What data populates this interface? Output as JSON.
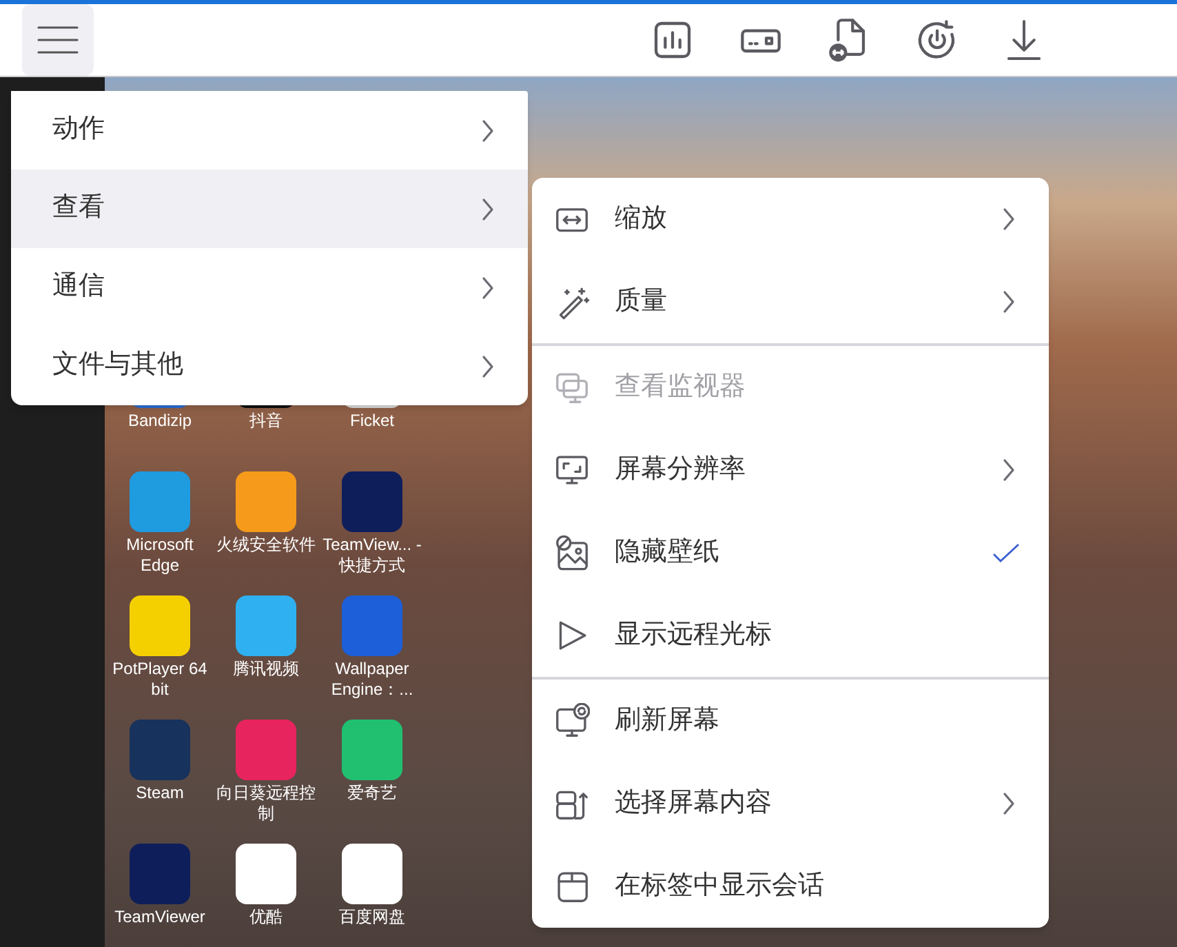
{
  "main_menu": {
    "items": [
      {
        "label": "动作",
        "selected": false
      },
      {
        "label": "查看",
        "selected": true
      },
      {
        "label": "通信",
        "selected": false
      },
      {
        "label": "文件与其他",
        "selected": false
      }
    ]
  },
  "view_submenu": {
    "groups": [
      [
        {
          "label": "缩放",
          "kind": "submenu",
          "disabled": false
        },
        {
          "label": "质量",
          "kind": "submenu",
          "disabled": false
        }
      ],
      [
        {
          "label": "查看监视器",
          "kind": "action",
          "disabled": true
        },
        {
          "label": "屏幕分辨率",
          "kind": "submenu",
          "disabled": false
        },
        {
          "label": "隐藏壁纸",
          "kind": "toggle",
          "checked": true,
          "disabled": false
        },
        {
          "label": "显示远程光标",
          "kind": "toggle",
          "checked": false,
          "disabled": false
        }
      ],
      [
        {
          "label": "刷新屏幕",
          "kind": "action",
          "disabled": false
        },
        {
          "label": "选择屏幕内容",
          "kind": "submenu",
          "disabled": false
        },
        {
          "label": "在标签中显示会话",
          "kind": "action",
          "disabled": false
        }
      ]
    ]
  },
  "remote_desktop": {
    "icons": [
      {
        "label": "Bandizip"
      },
      {
        "label": "抖音"
      },
      {
        "label": "Ficket"
      },
      {
        "label": "Microsoft Edge"
      },
      {
        "label": "火绒安全软件"
      },
      {
        "label": "TeamView... - 快捷方式"
      },
      {
        "label": "PotPlayer 64 bit"
      },
      {
        "label": "腾讯视频"
      },
      {
        "label": "Wallpaper Engine：..."
      },
      {
        "label": "Steam"
      },
      {
        "label": "向日葵远程控制"
      },
      {
        "label": "爱奇艺"
      },
      {
        "label": "TeamViewer"
      },
      {
        "label": "优酷"
      },
      {
        "label": "百度网盘"
      }
    ]
  }
}
